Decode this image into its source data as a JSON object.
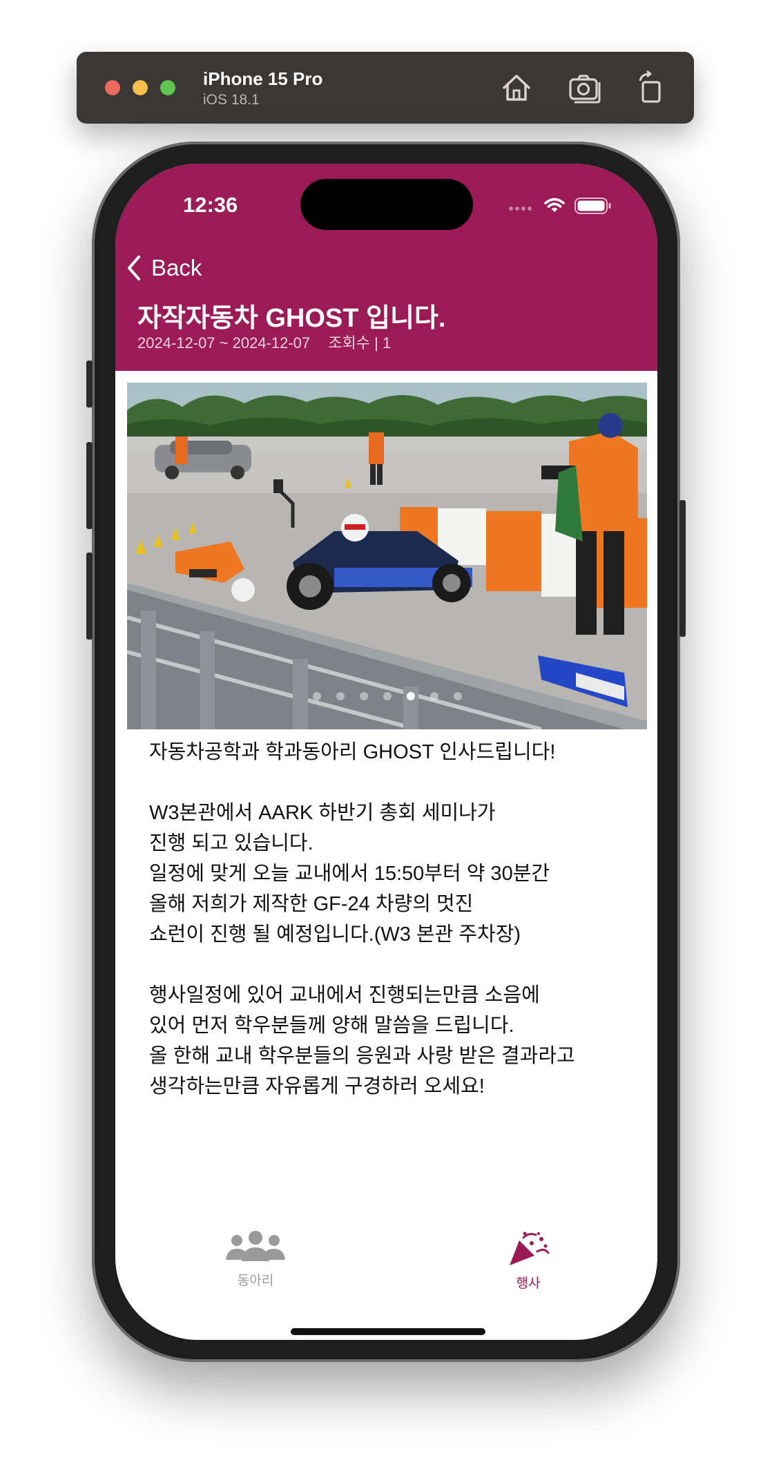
{
  "simulator": {
    "device_name": "iPhone 15 Pro",
    "os_version": "iOS 18.1"
  },
  "status_bar": {
    "time": "12:36"
  },
  "nav": {
    "back_label": "Back"
  },
  "post": {
    "title": "자작자동차 GHOST 입니다.",
    "date_range": "2024-12-07 ~ 2024-12-07",
    "views": "조회수 | 1",
    "carousel": {
      "photo_count": 7,
      "active_index": 4
    },
    "body_lines": [
      "자동차공학과 학과동아리 GHOST 인사드립니다!",
      "",
      "W3본관에서 AARK 하반기 총회 세미나가",
      "진행 되고 있습니다.",
      "일정에 맞게 오늘 교내에서 15:50부터 약 30분간",
      "올해 저희가 제작한 GF-24 차량의 멋진",
      "쇼런이 진행 될 예정입니다.(W3 본관 주차장)",
      "",
      "행사일정에 있어 교내에서 진행되는만큼 소음에",
      "있어 먼저 학우분들께 양해 말씀을 드립니다.",
      "올 한해 교내 학우분들의 응원과 사랑 받은 결과라고",
      "생각하는만큼 자유롭게 구경하러 오세요!"
    ]
  },
  "tab_bar": {
    "tabs": [
      {
        "label": "동아리",
        "icon": "people-icon",
        "active": false
      },
      {
        "label": "행사",
        "icon": "party-popper-icon",
        "active": true
      }
    ]
  },
  "colors": {
    "brand": "#9b1b56",
    "inactive_tab": "#9a9a9a"
  }
}
